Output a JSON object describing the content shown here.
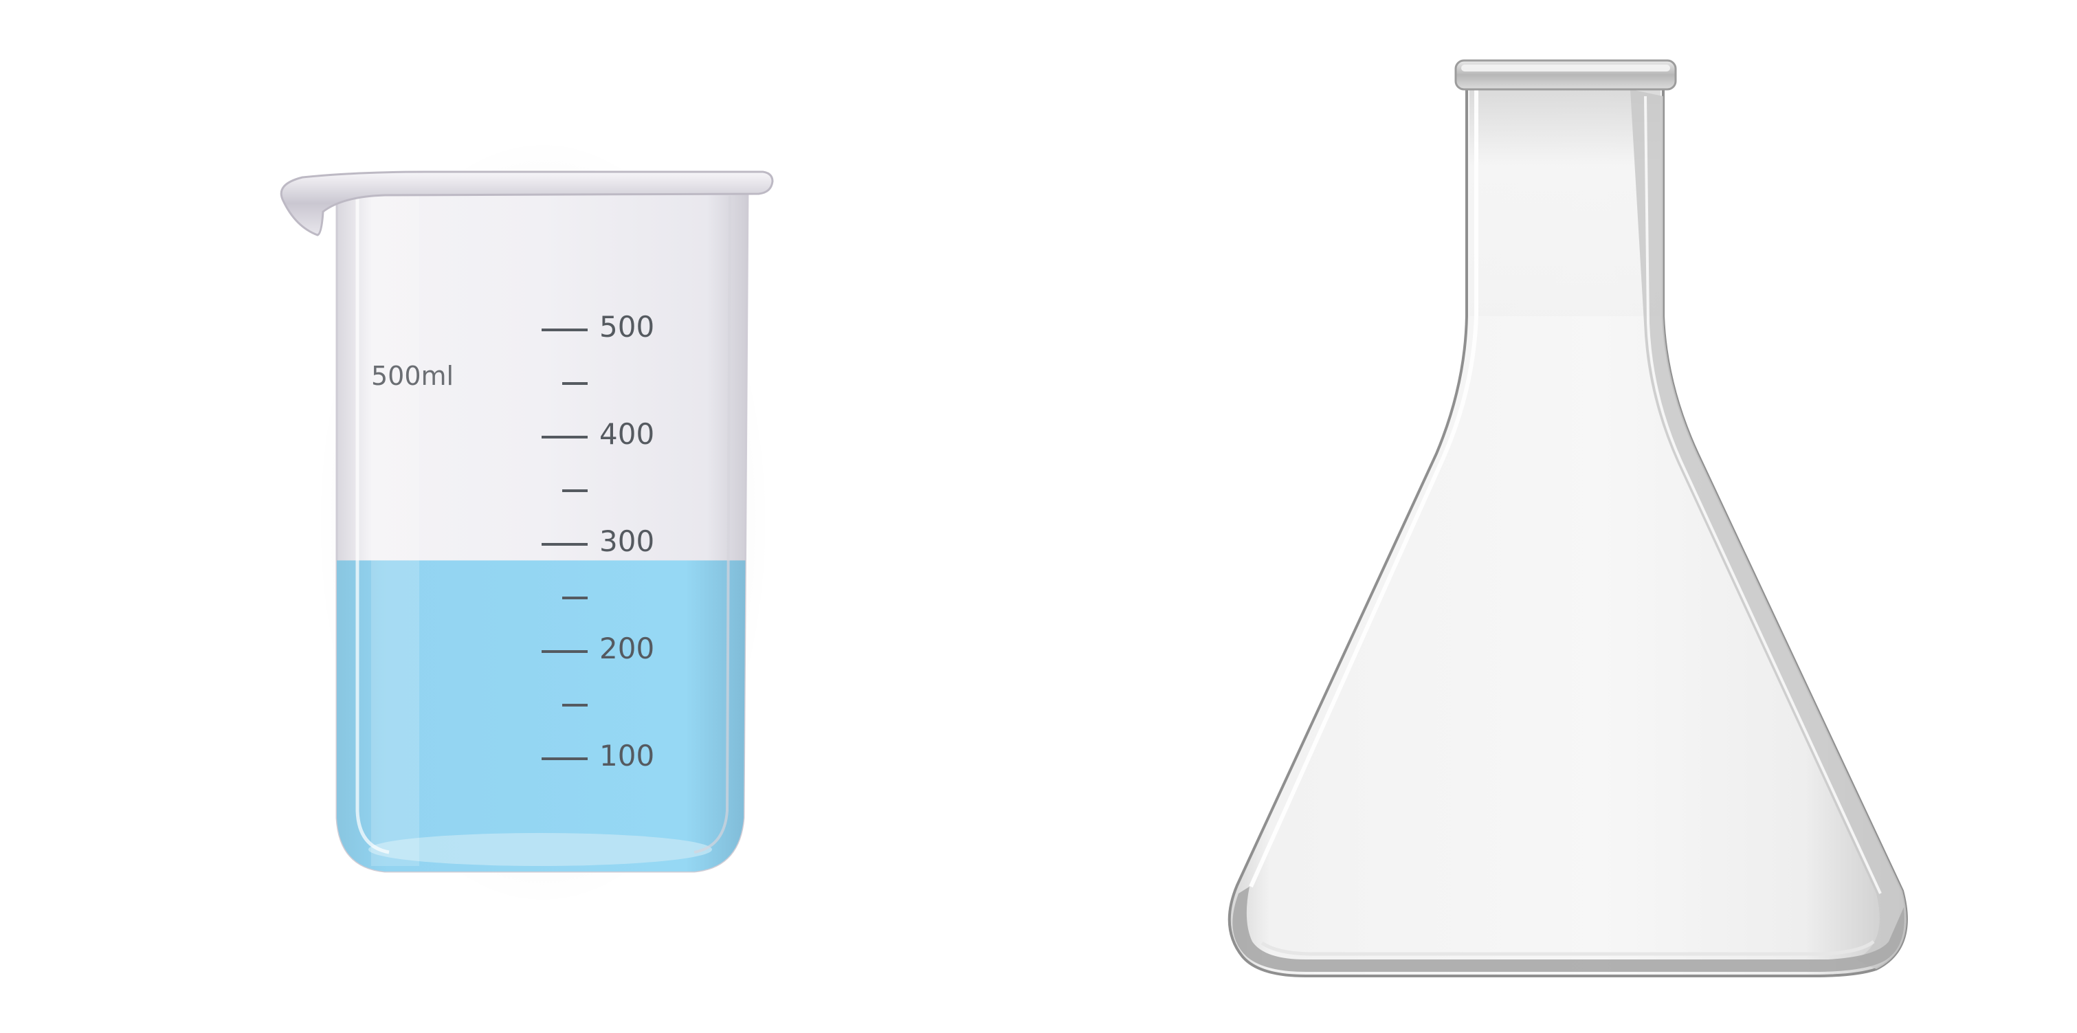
{
  "beaker": {
    "capacity_label": "500ml",
    "graduations": [
      {
        "label": "500"
      },
      {
        "label": ""
      },
      {
        "label": "400"
      },
      {
        "label": ""
      },
      {
        "label": "300"
      },
      {
        "label": ""
      },
      {
        "label": "200"
      },
      {
        "label": ""
      },
      {
        "label": "100"
      }
    ],
    "liquid_level_ml": 285,
    "liquid_color": "#93d4f1",
    "glass_tint": "#efeef2"
  },
  "flask": {
    "glass_tint": "#f3f3f3",
    "rim_color": "#bdbdbd"
  }
}
